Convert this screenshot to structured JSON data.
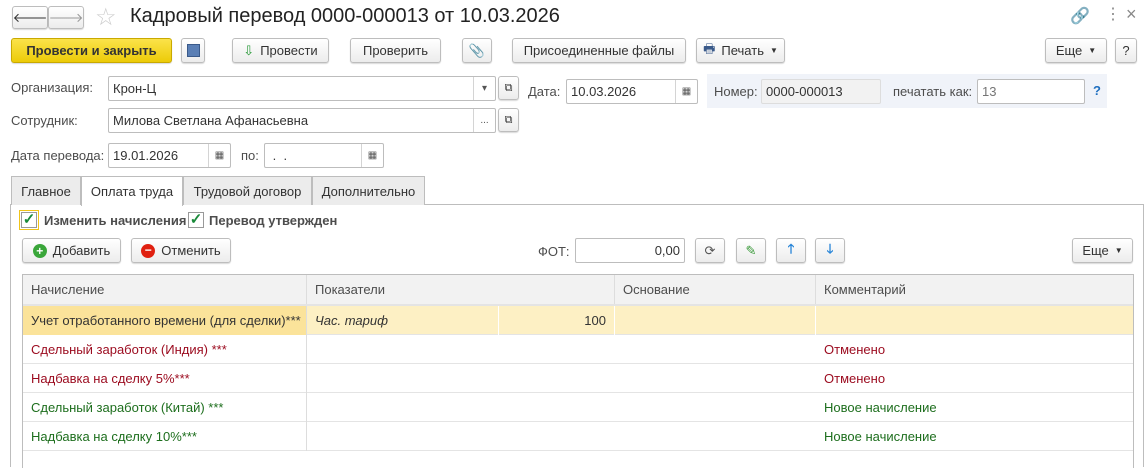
{
  "window": {
    "title": "Кадровый перевод 0000-000013 от 10.03.2026"
  },
  "toolbar": {
    "post_close": "Провести и закрыть",
    "post": "Провести",
    "check": "Проверить",
    "attached": "Присоединенные файлы",
    "print": "Печать",
    "more": "Еще",
    "help": "?"
  },
  "form": {
    "org_label": "Организация:",
    "org_value": "Крон-Ц",
    "date_label": "Дата:",
    "date_value": "10.03.2026",
    "number_label": "Номер:",
    "number_value": "0000-000013",
    "print_as_label": "печатать как:",
    "print_as_placeholder": "13",
    "print_as_help": "?",
    "employee_label": "Сотрудник:",
    "employee_value": "Милова Светлана Афанасьевна",
    "transfer_date_label": "Дата перевода:",
    "transfer_date_value": "19.01.2026",
    "to_label": "по:",
    "to_value": " .  ."
  },
  "tabs": [
    {
      "label": "Главное"
    },
    {
      "label": "Оплата труда"
    },
    {
      "label": "Трудовой договор"
    },
    {
      "label": "Дополнительно"
    }
  ],
  "pay": {
    "change_accruals": "Изменить начисления",
    "change_accruals_checked": true,
    "approved": "Перевод утвержден",
    "approved_checked": true,
    "add": "Добавить",
    "cancel": "Отменить",
    "fot_label": "ФОТ:",
    "fot_value": "0,00",
    "more": "Еще"
  },
  "table": {
    "columns": [
      "Начисление",
      "Показатели",
      "Основание",
      "Комментарий"
    ],
    "rows": [
      {
        "name": "Учет отработанного времени (для сделки)***",
        "indicator": "Час. тариф",
        "value": "100",
        "basis": "",
        "comment": "",
        "status": "normal"
      },
      {
        "name": "Сдельный заработок (Индия) ***",
        "indicator": "",
        "value": "",
        "basis": "",
        "comment": "Отменено",
        "status": "cancelled"
      },
      {
        "name": "Надбавка на сделку 5%***",
        "indicator": "",
        "value": "",
        "basis": "",
        "comment": "Отменено",
        "status": "cancelled"
      },
      {
        "name": "Сдельный заработок (Китай) ***",
        "indicator": "",
        "value": "",
        "basis": "",
        "comment": "Новое начисление",
        "status": "new"
      },
      {
        "name": "Надбавка на сделку 10%***",
        "indicator": "",
        "value": "",
        "basis": "",
        "comment": "Новое начисление",
        "status": "new"
      }
    ]
  },
  "colors": {
    "primary_button": "#f5d313",
    "cancelled": "#9b0a1e",
    "new": "#1d6e1d",
    "selected_row": "#fdf0c4",
    "help": "#1f6fc0"
  }
}
